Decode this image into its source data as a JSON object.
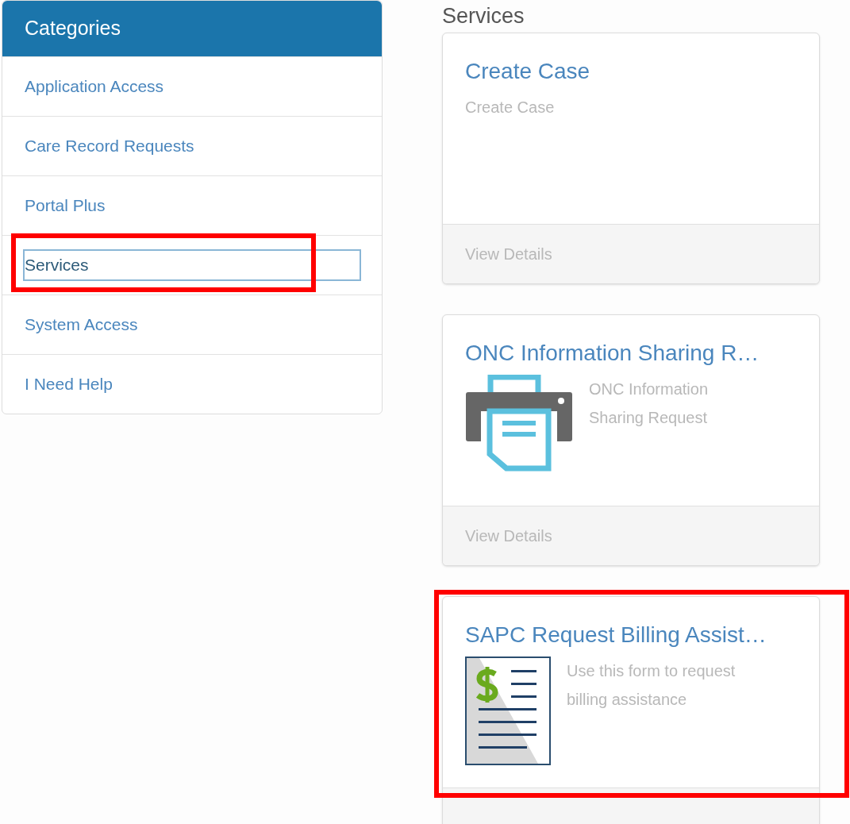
{
  "sidebar": {
    "title": "Categories",
    "items": [
      {
        "label": "Application Access",
        "selected": false,
        "highlighted": false
      },
      {
        "label": "Care Record Requests",
        "selected": false,
        "highlighted": false
      },
      {
        "label": "Portal Plus",
        "selected": false,
        "highlighted": false
      },
      {
        "label": "Services",
        "selected": true,
        "highlighted": true
      },
      {
        "label": "System Access",
        "selected": false,
        "highlighted": false
      },
      {
        "label": "I Need Help",
        "selected": false,
        "highlighted": false
      }
    ]
  },
  "section_title": "Services",
  "cards": [
    {
      "title": "Create Case",
      "description": "Create Case",
      "kind": "plain",
      "footer": "View Details",
      "highlighted": false
    },
    {
      "title": "ONC Information Sharing R…",
      "description": "ONC Information Sharing Request",
      "kind": "printer",
      "footer": "View Details",
      "highlighted": false
    },
    {
      "title": "SAPC Request Billing Assist…",
      "description": "Use this form to request billing assistance",
      "kind": "billing",
      "highlighted": true
    }
  ]
}
